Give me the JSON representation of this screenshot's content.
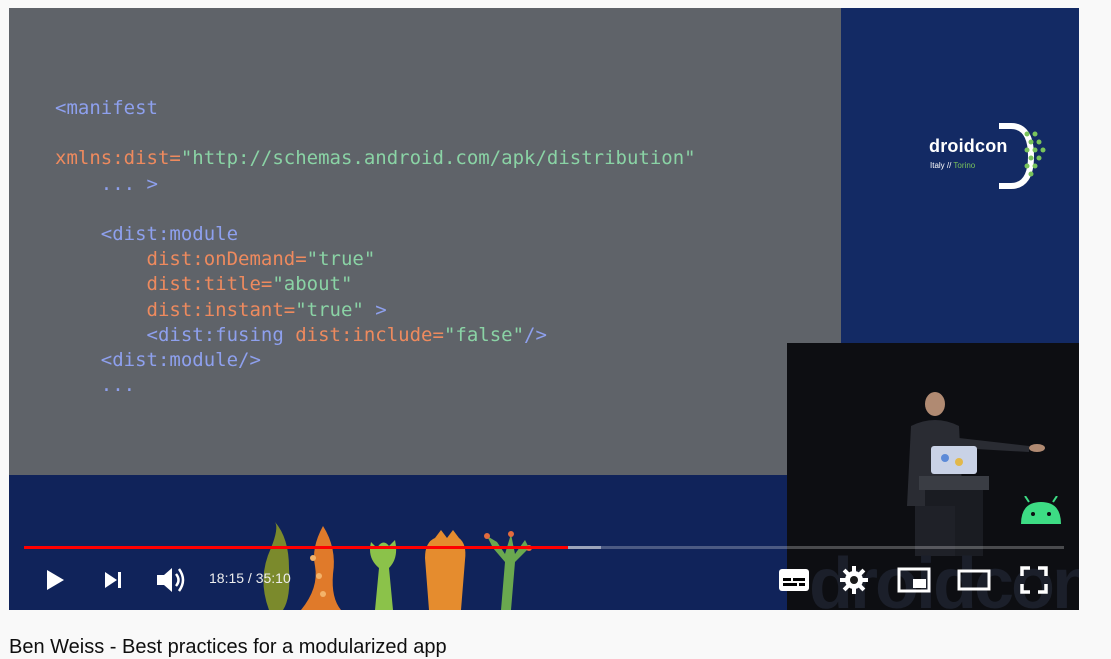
{
  "slide": {
    "lines": [
      [
        {
          "t": "<manifest",
          "c": "kw"
        }
      ],
      [],
      [
        {
          "t": "xmlns:dist=",
          "c": "at"
        },
        {
          "t": "\"http://schemas.android.com/apk/distribution\"",
          "c": "st"
        }
      ],
      [
        {
          "t": "    ... >",
          "c": "kw"
        }
      ],
      [],
      [
        {
          "t": "    <dist:module",
          "c": "kw"
        }
      ],
      [
        {
          "t": "        dist:onDemand=",
          "c": "at"
        },
        {
          "t": "\"true\"",
          "c": "st"
        }
      ],
      [
        {
          "t": "        dist:title=",
          "c": "at"
        },
        {
          "t": "\"about\"",
          "c": "st"
        }
      ],
      [
        {
          "t": "        dist:instant=",
          "c": "at"
        },
        {
          "t": "\"true\"",
          "c": "st"
        },
        {
          "t": " >",
          "c": "kw"
        }
      ],
      [
        {
          "t": "        <dist:fusing ",
          "c": "kw"
        },
        {
          "t": "dist:include=",
          "c": "at"
        },
        {
          "t": "\"false\"",
          "c": "st"
        },
        {
          "t": "/>",
          "c": "kw"
        }
      ],
      [
        {
          "t": "    <dist:module/>",
          "c": "kw"
        }
      ],
      [
        {
          "t": "    ...",
          "c": "kw"
        }
      ]
    ]
  },
  "logo": {
    "name": "droidcon",
    "subtitle_city": "Italy // ",
    "subtitle_accent": "Torino"
  },
  "watermark": "droidcon",
  "player": {
    "played_fraction": 0.523,
    "buffered_fraction": 0.555,
    "time_display": "18:15 / 35:10",
    "controls": {
      "play": "play-icon",
      "next": "next-icon",
      "volume": "volume-icon",
      "subtitles": "subtitles-icon",
      "settings": "gear-icon",
      "miniplayer": "miniplayer-icon",
      "theater": "theater-mode-icon",
      "fullscreen": "fullscreen-icon"
    }
  },
  "video_title": "Ben Weiss - Best practices for a modularized app",
  "colors": {
    "progress_played": "#ff0000",
    "slide_bg": "#5f6369",
    "stage_blue": "#132a64",
    "code_tag": "#8ea0ee",
    "code_attr": "#ee8a5e",
    "code_string": "#8ad3a5"
  }
}
